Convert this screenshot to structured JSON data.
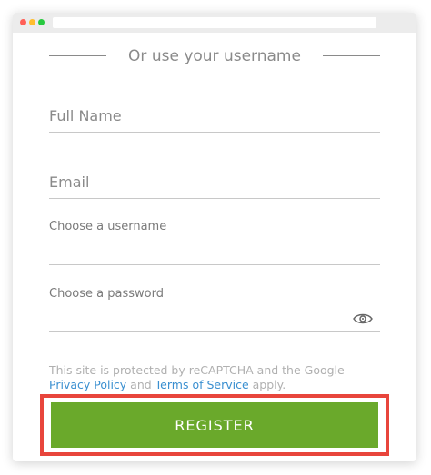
{
  "window": {
    "url": ""
  },
  "divider": {
    "text": "Or use your username"
  },
  "fields": {
    "full_name": {
      "placeholder": "Full Name",
      "value": ""
    },
    "email": {
      "placeholder": "Email",
      "value": ""
    },
    "username": {
      "label": "Choose a username",
      "value": ""
    },
    "password": {
      "label": "Choose a password",
      "value": "",
      "toggle_icon": "eye-icon"
    }
  },
  "legal": {
    "prefix": "This site is protected by reCAPTCHA and the Google ",
    "privacy_link": "Privacy Policy",
    "middle": " and ",
    "terms_link": "Terms of Service",
    "suffix": " apply."
  },
  "register": {
    "label": "REGISTER"
  },
  "colors": {
    "accent_green": "#6aa92b",
    "highlight_red": "#e8453c",
    "link_blue": "#3a8fd0"
  }
}
